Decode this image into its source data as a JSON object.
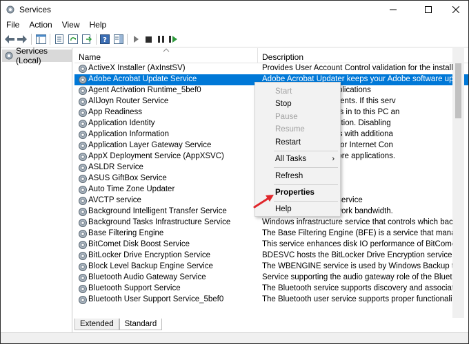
{
  "window": {
    "title": "Services"
  },
  "menu": [
    "File",
    "Action",
    "View",
    "Help"
  ],
  "tree": {
    "root_label": "Services (Local)"
  },
  "list": {
    "col_name": "Name",
    "col_desc": "Description",
    "rows": [
      {
        "name": "ActiveX Installer (AxInstSV)",
        "desc": "Provides User Account Control validation for the installation of A"
      },
      {
        "name": "Adobe Acrobat Update Service",
        "desc": "Adobe Acrobat Updater keeps your Adobe software up to date."
      },
      {
        "name": "Agent Activation Runtime_5bef0",
        "desc": "nversational agent applications"
      },
      {
        "name": "AllJoyn Router Service",
        "desc": "for the local AllJoyn clients. If this serv"
      },
      {
        "name": "App Readiness",
        "desc": "e first time a user signs in to this PC an"
      },
      {
        "name": "Application Identity",
        "desc": "e identity of an application. Disabling"
      },
      {
        "name": "Application Information",
        "desc": "interactive applications with additiona"
      },
      {
        "name": "Application Layer Gateway Service",
        "desc": "arty protocol plug-ins for Internet Con"
      },
      {
        "name": "AppX Deployment Service (AppXSVC)",
        "desc": "pport for deploying Store applications."
      },
      {
        "name": "ASLDR Service",
        "desc": ""
      },
      {
        "name": "ASUS GiftBox Service",
        "desc": ""
      },
      {
        "name": "Auto Time Zone Updater",
        "desc": "item time zone."
      },
      {
        "name": "AVCTP service",
        "desc": "ol Transport Protocol service"
      },
      {
        "name": "Background Intelligent Transfer Service",
        "desc": "ground using idle network bandwidth."
      },
      {
        "name": "Background Tasks Infrastructure Service",
        "desc": "Windows infrastructure service that controls which background"
      },
      {
        "name": "Base Filtering Engine",
        "desc": "The Base Filtering Engine (BFE) is a service that manages firewall"
      },
      {
        "name": "BitComet Disk Boost Service",
        "desc": "This service enhances disk IO performance of BitComet."
      },
      {
        "name": "BitLocker Drive Encryption Service",
        "desc": "BDESVC hosts the BitLocker Drive Encryption service. BitLocker D"
      },
      {
        "name": "Block Level Backup Engine Service",
        "desc": "The WBENGINE service is used by Windows Backup to perform b"
      },
      {
        "name": "Bluetooth Audio Gateway Service",
        "desc": "Service supporting the audio gateway role of the Bluetooth Han"
      },
      {
        "name": "Bluetooth Support Service",
        "desc": "The Bluetooth service supports discovery and association of rem"
      },
      {
        "name": "Bluetooth User Support Service_5bef0",
        "desc": "The Bluetooth user service supports proper functionality of Blue"
      }
    ]
  },
  "tabs": [
    "Extended",
    "Standard"
  ],
  "context_menu": {
    "start": "Start",
    "stop": "Stop",
    "pause": "Pause",
    "resume": "Resume",
    "restart": "Restart",
    "all_tasks": "All Tasks",
    "refresh": "Refresh",
    "properties": "Properties",
    "help": "Help"
  },
  "colors": {
    "selection": "#0078d7",
    "callout_arrow": "#e0262b"
  }
}
